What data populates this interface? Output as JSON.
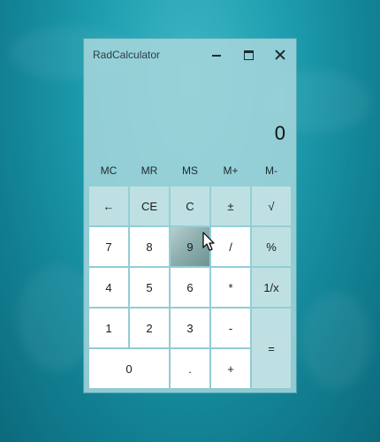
{
  "window": {
    "title": "RadCalculator"
  },
  "display": {
    "value": "0"
  },
  "memory_buttons": [
    "MC",
    "MR",
    "MS",
    "M+",
    "M-"
  ],
  "keys": {
    "row1": [
      "←",
      "CE",
      "C",
      "±",
      "√"
    ],
    "row2": [
      "7",
      "8",
      "9",
      "/",
      "%"
    ],
    "row3": [
      "4",
      "5",
      "6",
      "*",
      "1/x"
    ],
    "row4": [
      "1",
      "2",
      "3",
      "-"
    ],
    "row5": [
      "0",
      ".",
      "+"
    ],
    "equals": "="
  },
  "pressed_key": "9",
  "icons": {
    "minimize": "minimize-icon",
    "maximize": "maximize-icon",
    "close": "close-icon",
    "cursor": "mouse-pointer-icon"
  },
  "colors": {
    "window_background": "#a6d6dc",
    "operator_key": "#bfe0e3",
    "number_key": "#ffffff",
    "desktop_water": "#1e9fb0"
  }
}
